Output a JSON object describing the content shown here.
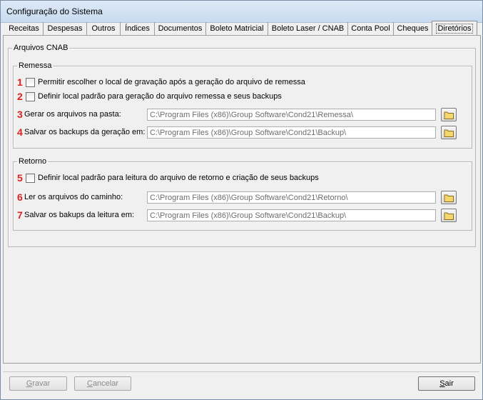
{
  "window": {
    "title": "Configuração do Sistema"
  },
  "tabs": [
    {
      "label": "Receitas"
    },
    {
      "label": "Despesas"
    },
    {
      "label": "Outros"
    },
    {
      "label": "Índices"
    },
    {
      "label": "Documentos"
    },
    {
      "label": "Boleto Matricial"
    },
    {
      "label": "Boleto Laser / CNAB"
    },
    {
      "label": "Conta Pool"
    },
    {
      "label": "Cheques"
    },
    {
      "label": "Diretórios",
      "active": true
    }
  ],
  "cnab": {
    "legend": "Arquivos CNAB",
    "remessa": {
      "legend": "Remessa",
      "items": [
        {
          "num": "1",
          "label": "Permitir escolher o local de gravação após a geração do arquivo de remessa",
          "checked": false
        },
        {
          "num": "2",
          "label": "Definir local padrão para geração do arquivo remessa e seus backups",
          "checked": false
        },
        {
          "num": "3",
          "label": "Gerar os arquivos na pasta:",
          "value": "C:\\Program Files (x86)\\Group Software\\Cond21\\Remessa\\"
        },
        {
          "num": "4",
          "label": "Salvar os backups da geração em:",
          "value": "C:\\Program Files (x86)\\Group Software\\Cond21\\Backup\\"
        }
      ]
    },
    "retorno": {
      "legend": "Retorno",
      "items": [
        {
          "num": "5",
          "label": "Definir local padrão para leitura do arquivo de retorno e criação de seus backups",
          "checked": false
        },
        {
          "num": "6",
          "label": "Ler os arquivos do caminho:",
          "value": "C:\\Program Files (x86)\\Group Software\\Cond21\\Retorno\\"
        },
        {
          "num": "7",
          "label": "Salvar os bakups da leitura em:",
          "value": "C:\\Program Files (x86)\\Group Software\\Cond21\\Backup\\"
        }
      ]
    }
  },
  "buttons": {
    "gravar": {
      "underline": "G",
      "rest": "ravar",
      "enabled": false
    },
    "cancelar": {
      "underline": "C",
      "rest": "ancelar",
      "enabled": false
    },
    "sair": {
      "underline": "S",
      "rest": "air",
      "enabled": true
    }
  },
  "icons": {
    "folder": "folder-icon"
  },
  "colors": {
    "annotation": "#e02020",
    "folder": "#f5d76e"
  }
}
